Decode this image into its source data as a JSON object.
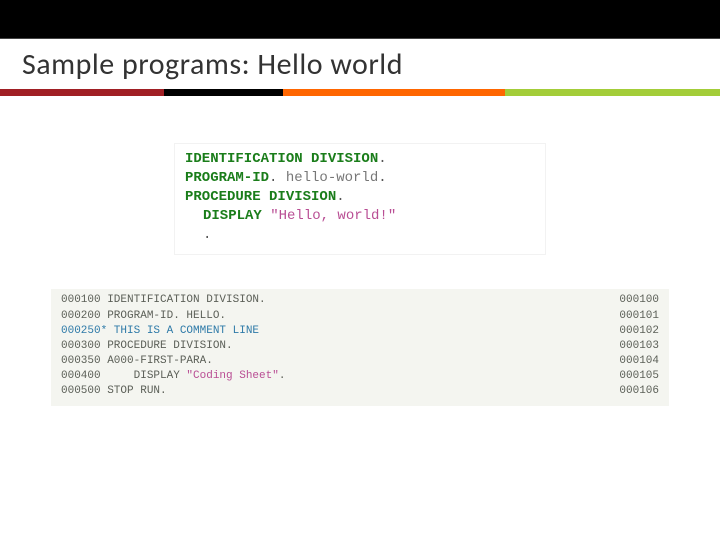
{
  "title": "Sample programs: Hello world",
  "code1": {
    "l1_kw": "IDENTIFICATION DIVISION",
    "l1_dot": ".",
    "l2_kw": "PROGRAM-ID",
    "l2_dot1": ".",
    "l2_id": " hello-world",
    "l2_dot2": ".",
    "l3_kw": "PROCEDURE DIVISION",
    "l3_dot": ".",
    "l4_kw": "DISPLAY",
    "l4_str": " \"Hello, world!\"",
    "l5": "."
  },
  "code2": [
    {
      "left": "000100 IDENTIFICATION DIVISION.",
      "right": "000100"
    },
    {
      "left": "000200 PROGRAM-ID. HELLO.",
      "right": "000101"
    },
    {
      "left": "000250* THIS IS A COMMENT LINE",
      "comment": true,
      "right": "000102"
    },
    {
      "left": "000300 PROCEDURE DIVISION.",
      "right": "000103"
    },
    {
      "left": "000350 A000-FIRST-PARA.",
      "right": "000104"
    },
    {
      "left_a": "000400     DISPLAY ",
      "left_b": "\"Coding Sheet\"",
      "left_c": ".",
      "right": "000105"
    },
    {
      "left": "000500 STOP RUN.",
      "right": "000106"
    }
  ]
}
